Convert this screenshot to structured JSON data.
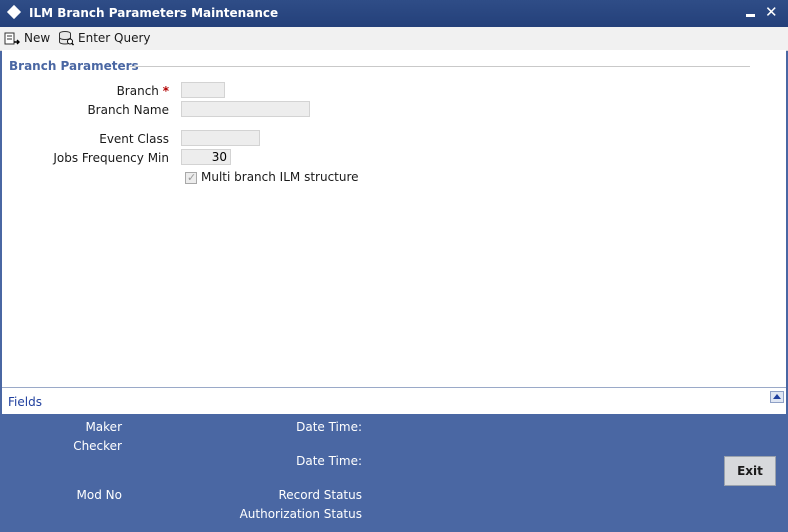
{
  "window": {
    "title": "ILM Branch Parameters Maintenance",
    "minimize_glyph": "",
    "close_glyph": "✕"
  },
  "toolbar": {
    "new_label": "New",
    "new_icon": "new-record-icon",
    "enter_query_label": "Enter Query",
    "enter_query_icon": "enter-query-icon"
  },
  "form": {
    "section_title": "Branch Parameters",
    "branch_label": "Branch",
    "required_marker": "*",
    "branch_value": "",
    "branch_name_label": "Branch Name",
    "branch_name_value": "",
    "event_class_label": "Event Class",
    "event_class_value": "",
    "jobs_freq_label": "Jobs Frequency Min",
    "jobs_freq_value": "30",
    "multi_branch_label": "Multi branch ILM structure",
    "multi_branch_checked": true
  },
  "fields_bar": {
    "label": "Fields",
    "collapse_icon": "collapse-up-icon"
  },
  "footer": {
    "maker_label": "Maker",
    "maker_datetime_label": "Date Time:",
    "checker_label": "Checker",
    "checker_datetime_label": "Date Time:",
    "mod_no_label": "Mod No",
    "record_status_label": "Record Status",
    "auth_status_label": "Authorization Status",
    "exit_label": "Exit"
  },
  "colors": {
    "title_bar": "#2f4d87",
    "footer": "#4a67a3",
    "section_title": "#4a67a3",
    "required": "#b20000",
    "fields_link": "#1f3f9e"
  }
}
